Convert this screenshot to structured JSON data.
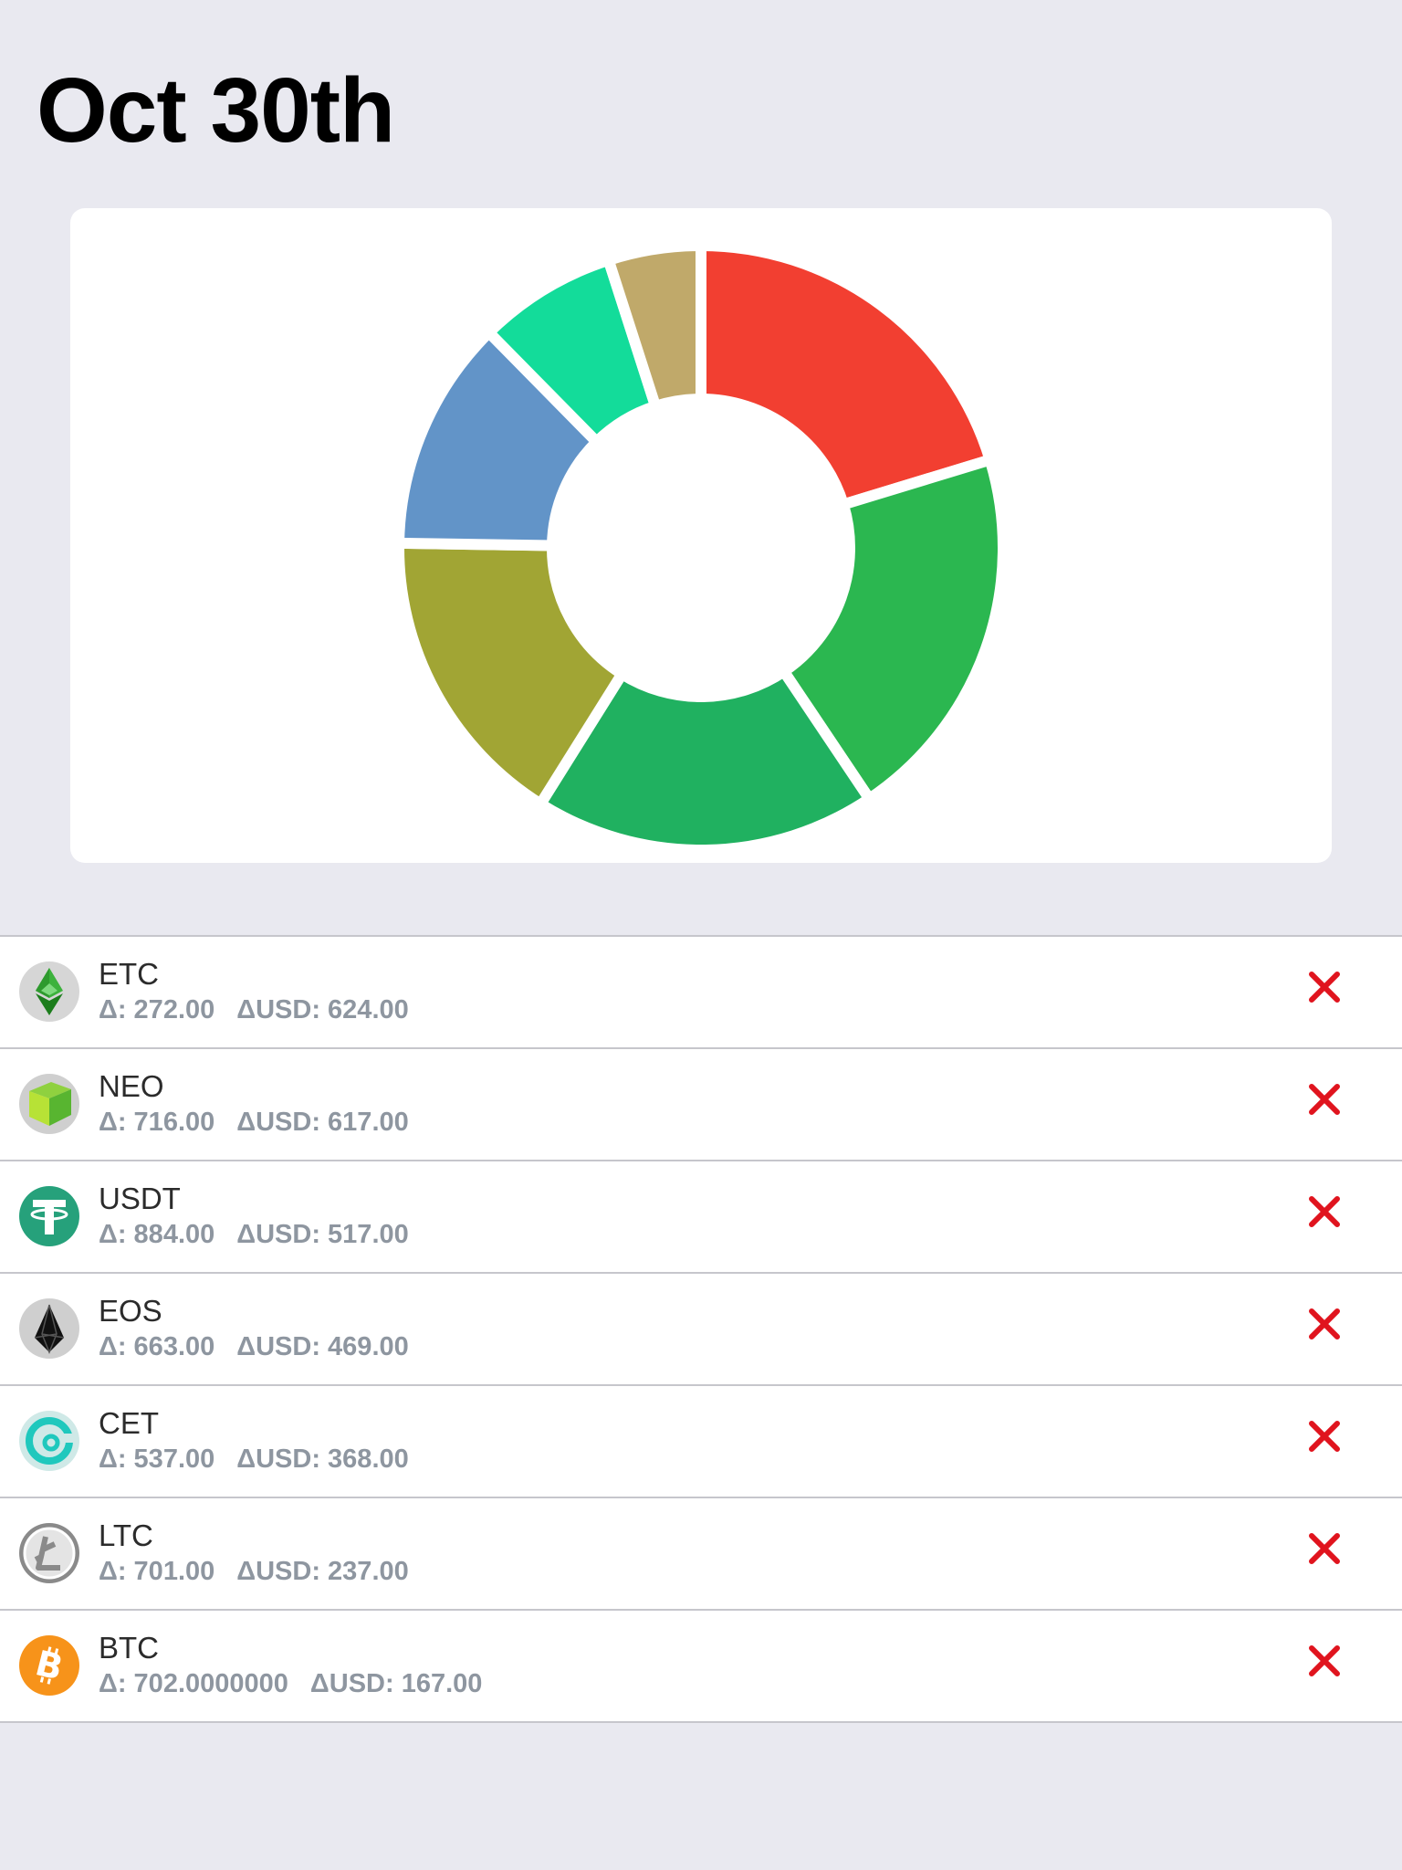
{
  "header": {
    "title": "Oct 30th"
  },
  "chart_data": {
    "type": "pie",
    "style": "donut",
    "slices": [
      {
        "color": "#f23f31",
        "value": 0.205
      },
      {
        "color": "#2bb750",
        "value": 0.205
      },
      {
        "color": "#20b160",
        "value": 0.185
      },
      {
        "color": "#a1a534",
        "value": 0.165
      },
      {
        "color": "#6294c8",
        "value": 0.125
      },
      {
        "color": "#13dc9a",
        "value": 0.075
      },
      {
        "color": "#c0a96a",
        "value": 0.05
      }
    ]
  },
  "assets": [
    {
      "symbol": "ETC",
      "delta": "Δ: 272.00",
      "delta_usd": "ΔUSD: 624.00",
      "icon": "etc-icon"
    },
    {
      "symbol": "NEO",
      "delta": "Δ: 716.00",
      "delta_usd": "ΔUSD: 617.00",
      "icon": "neo-icon"
    },
    {
      "symbol": "USDT",
      "delta": "Δ: 884.00",
      "delta_usd": "ΔUSD: 517.00",
      "icon": "usdt-icon"
    },
    {
      "symbol": "EOS",
      "delta": "Δ: 663.00",
      "delta_usd": "ΔUSD: 469.00",
      "icon": "eos-icon"
    },
    {
      "symbol": "CET",
      "delta": "Δ: 537.00",
      "delta_usd": "ΔUSD: 368.00",
      "icon": "cet-icon"
    },
    {
      "symbol": "LTC",
      "delta": "Δ: 701.00",
      "delta_usd": "ΔUSD: 237.00",
      "icon": "ltc-icon"
    },
    {
      "symbol": "BTC",
      "delta": "Δ: 702.0000000",
      "delta_usd": "ΔUSD: 167.00",
      "icon": "btc-icon"
    }
  ],
  "colors": {
    "delete": "#e0141e",
    "background": "#e9e9f0"
  }
}
